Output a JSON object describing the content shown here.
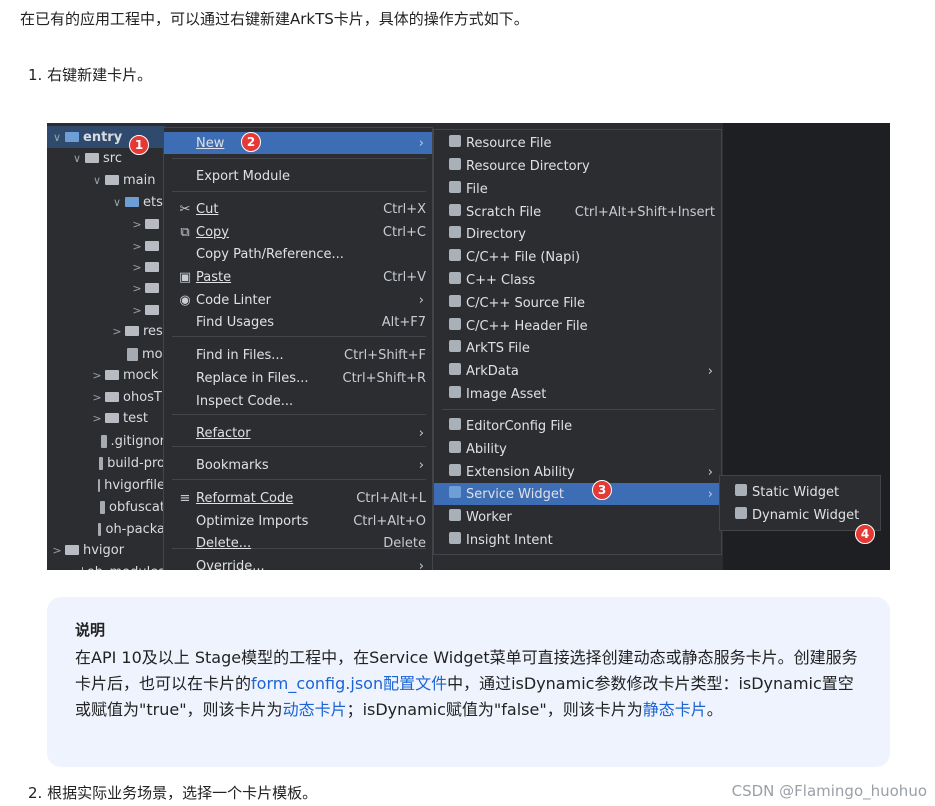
{
  "intro": "在已有的应用工程中，可以通过右键新建ArkTS卡片，具体的操作方式如下。",
  "step1": "1. 右键新建卡片。",
  "step2": "2. 根据实际业务场景，选择一个卡片模板。",
  "tree": [
    {
      "label": "entry",
      "chev": "∨",
      "type": "folder-blue",
      "bold": true,
      "selected": true
    },
    {
      "label": "src",
      "chev": "∨",
      "type": "folder"
    },
    {
      "label": "main",
      "chev": "∨",
      "type": "folder"
    },
    {
      "label": "ets",
      "chev": "∨",
      "type": "folder-blue"
    },
    {
      "label": "",
      "chev": ">",
      "type": "folder"
    },
    {
      "label": "",
      "chev": ">",
      "type": "folder"
    },
    {
      "label": "",
      "chev": ">",
      "type": "folder"
    },
    {
      "label": "",
      "chev": ">",
      "type": "folder"
    },
    {
      "label": "",
      "chev": ">",
      "type": "folder"
    },
    {
      "label": "res",
      "chev": ">",
      "type": "folder"
    },
    {
      "label": "mo",
      "chev": "",
      "type": "file"
    },
    {
      "label": "mock",
      "chev": ">",
      "type": "folder"
    },
    {
      "label": "ohosT",
      "chev": ">",
      "type": "folder"
    },
    {
      "label": "test",
      "chev": ">",
      "type": "folder"
    },
    {
      "label": ".gitignor",
      "chev": "",
      "type": "file"
    },
    {
      "label": "build-pro",
      "chev": "",
      "type": "file"
    },
    {
      "label": "hvigorfile",
      "chev": "",
      "type": "file"
    },
    {
      "label": "obfuscat",
      "chev": "",
      "type": "file"
    },
    {
      "label": "oh-packa",
      "chev": "",
      "type": "file"
    },
    {
      "label": "hvigor",
      "chev": ">",
      "type": "folder"
    },
    {
      "label": "oh_modules",
      "chev": ">",
      "type": "folder"
    }
  ],
  "menu1": [
    {
      "icon": "",
      "label": "New",
      "shortcut": "",
      "arrow": true,
      "highlight": true
    },
    {
      "icon": "",
      "label": "Export Module",
      "shortcut": "",
      "arrow": false
    },
    {
      "icon": "✂",
      "label": "Cut",
      "shortcut": "Ctrl+X",
      "arrow": false
    },
    {
      "icon": "⧉",
      "label": "Copy",
      "shortcut": "Ctrl+C",
      "arrow": false
    },
    {
      "icon": "",
      "label": "Copy Path/Reference...",
      "shortcut": "",
      "arrow": false
    },
    {
      "icon": "▣",
      "label": "Paste",
      "shortcut": "Ctrl+V",
      "arrow": false
    },
    {
      "icon": "◉",
      "label": "Code Linter",
      "shortcut": "",
      "arrow": true
    },
    {
      "icon": "",
      "label": "Find Usages",
      "shortcut": "Alt+F7",
      "arrow": false
    },
    {
      "icon": "",
      "label": "Find in Files...",
      "shortcut": "Ctrl+Shift+F",
      "arrow": false
    },
    {
      "icon": "",
      "label": "Replace in Files...",
      "shortcut": "Ctrl+Shift+R",
      "arrow": false
    },
    {
      "icon": "",
      "label": "Inspect Code...",
      "shortcut": "",
      "arrow": false
    },
    {
      "icon": "",
      "label": "Refactor",
      "shortcut": "",
      "arrow": true
    },
    {
      "icon": "",
      "label": "Bookmarks",
      "shortcut": "",
      "arrow": true
    },
    {
      "icon": "≡",
      "label": "Reformat Code",
      "shortcut": "Ctrl+Alt+L",
      "arrow": false
    },
    {
      "icon": "",
      "label": "Optimize Imports",
      "shortcut": "Ctrl+Alt+O",
      "arrow": false
    },
    {
      "icon": "",
      "label": "Delete...",
      "shortcut": "Delete",
      "arrow": false
    },
    {
      "icon": "",
      "label": "Override...",
      "shortcut": "",
      "arrow": true
    }
  ],
  "menu2": [
    {
      "label": "Resource File",
      "shortcut": "",
      "arrow": false
    },
    {
      "label": "Resource Directory",
      "shortcut": "",
      "arrow": false
    },
    {
      "label": "File",
      "shortcut": "",
      "arrow": false
    },
    {
      "label": "Scratch File",
      "shortcut": "Ctrl+Alt+Shift+Insert",
      "arrow": false
    },
    {
      "label": "Directory",
      "shortcut": "",
      "arrow": false
    },
    {
      "label": "C/C++ File (Napi)",
      "shortcut": "",
      "arrow": false
    },
    {
      "label": "C++ Class",
      "shortcut": "",
      "arrow": false
    },
    {
      "label": "C/C++ Source File",
      "shortcut": "",
      "arrow": false
    },
    {
      "label": "C/C++ Header File",
      "shortcut": "",
      "arrow": false
    },
    {
      "label": "ArkTS File",
      "shortcut": "",
      "arrow": false
    },
    {
      "label": "ArkData",
      "shortcut": "",
      "arrow": true
    },
    {
      "label": "Image Asset",
      "shortcut": "",
      "arrow": false
    },
    {
      "label": "EditorConfig File",
      "shortcut": "",
      "arrow": false
    },
    {
      "label": "Ability",
      "shortcut": "",
      "arrow": false
    },
    {
      "label": "Extension Ability",
      "shortcut": "",
      "arrow": true
    },
    {
      "label": "Service Widget",
      "shortcut": "",
      "arrow": true,
      "highlight": true
    },
    {
      "label": "Worker",
      "shortcut": "",
      "arrow": false
    },
    {
      "label": "Insight Intent",
      "shortcut": "",
      "arrow": false
    }
  ],
  "menu3": [
    {
      "label": "Static Widget"
    },
    {
      "label": "Dynamic Widget"
    }
  ],
  "badges": [
    "1",
    "2",
    "3",
    "4"
  ],
  "note": {
    "title": "说明",
    "p1": "在API 10及以上 Stage模型的工程中，在Service Widget菜单可直接选择创建动态或静态服务卡片。创建服务卡片后，也可以在卡片的",
    "link1": "form_config.json配置文件",
    "p2": "中，通过isDynamic参数修改卡片类型：isDynamic置空或赋值为\"true\"，则该卡片为",
    "link2": "动态卡片",
    "p3": "；isDynamic赋值为\"false\"，则该卡片为",
    "link3": "静态卡片",
    "p4": "。"
  },
  "watermark": "CSDN @Flamingo_huohuo",
  "colors": {
    "highlight": "#3d6db5",
    "badge": "#e53935",
    "link": "#1a64d6",
    "note_bg": "#eef3fd"
  }
}
